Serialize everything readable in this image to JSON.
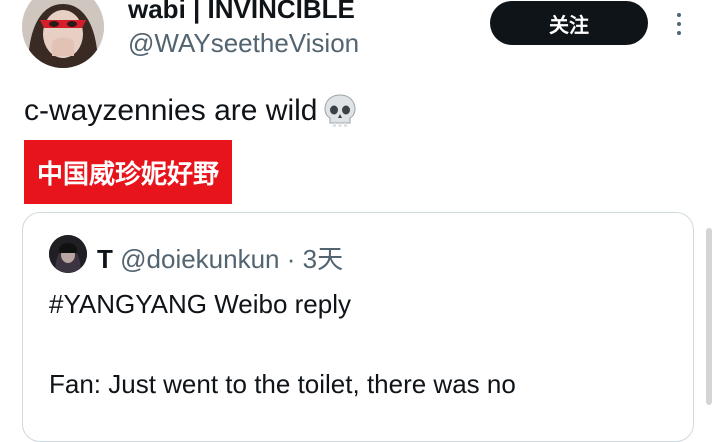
{
  "post": {
    "display_name": "wabi | INVINCIBLE",
    "handle": "@WAYseetheVision",
    "follow_label": "关注",
    "text": "c-wayzennies are wild",
    "emoji": "skull-icon",
    "caption": "中国威珍妮好野"
  },
  "quote": {
    "name": "T",
    "handle": "@doiekunkun",
    "separator": "·",
    "time": "3天",
    "line1": "#YANGYANG Weibo reply",
    "line2": "Fan: Just went to the toilet, there was no"
  },
  "colors": {
    "follow_button_bg": "#0f1419",
    "caption_bg": "#e8141b",
    "secondary_text": "#536471",
    "border": "#cfd9de"
  }
}
